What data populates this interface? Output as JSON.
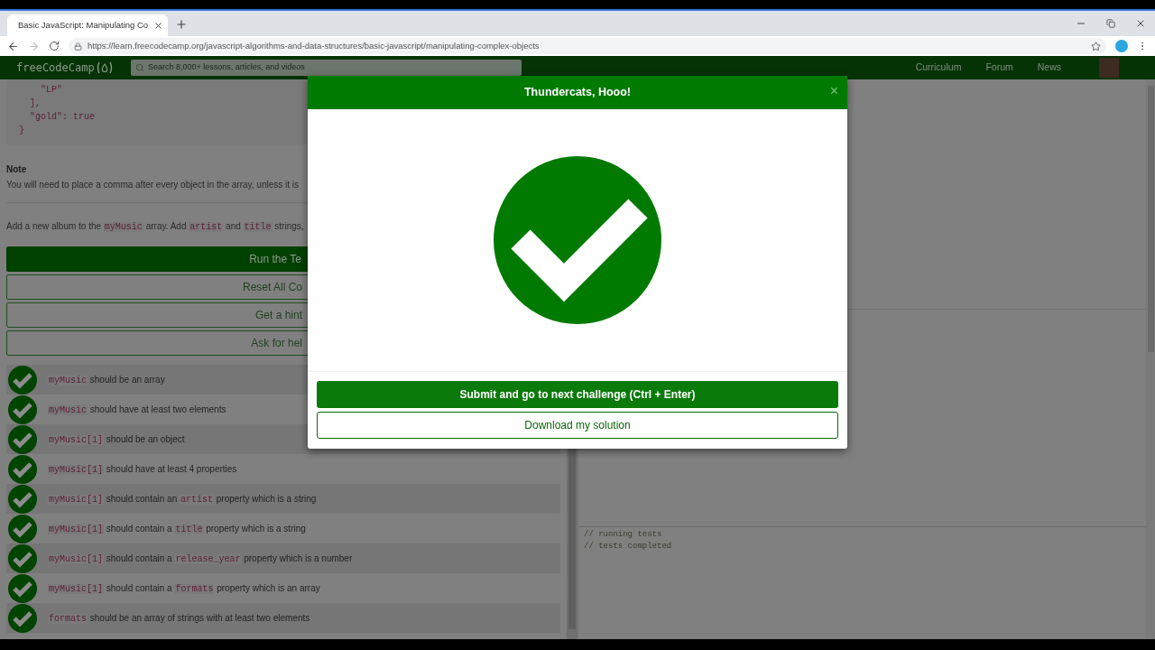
{
  "browser": {
    "tab": {
      "title": "Basic JavaScript: Manipulating Co",
      "selected": true
    },
    "url": "https://learn.freecodecamp.org/javascript-algorithms-and-data-structures/basic-javascript/manipulating-complex-objects"
  },
  "nav": {
    "logo": "freeCodeCamp",
    "search": {
      "placeholder": "Search 8,000+ lessons, articles, and videos"
    },
    "links": [
      "Curriculum",
      "Forum",
      "News"
    ]
  },
  "lesson": {
    "code_lines": [
      "    \"LP\"",
      "  ],",
      "  \"gold\": true",
      "}"
    ],
    "note": {
      "heading": "Note",
      "text": "You will need to place a comma after every object in the array, unless it is"
    },
    "instruction": [
      {
        "kind": "text",
        "text": "Add a new album to the "
      },
      {
        "kind": "code",
        "text": "myMusic"
      },
      {
        "kind": "text",
        "text": " array. Add "
      },
      {
        "kind": "code",
        "text": "artist"
      },
      {
        "kind": "text",
        "text": " and "
      },
      {
        "kind": "code",
        "text": "title"
      },
      {
        "kind": "text",
        "text": " strings,"
      }
    ],
    "buttons": [
      {
        "label": "Run the Te",
        "primary": true
      },
      {
        "label": "Reset All Co",
        "primary": false
      },
      {
        "label": "Get a hint",
        "primary": false
      },
      {
        "label": "Ask for hel",
        "primary": false
      }
    ],
    "tests": [
      {
        "passed": true,
        "parts": [
          {
            "kind": "code",
            "text": "myMusic"
          },
          {
            "kind": "text",
            "text": " should be an array"
          }
        ]
      },
      {
        "passed": true,
        "parts": [
          {
            "kind": "code",
            "text": "myMusic"
          },
          {
            "kind": "text",
            "text": " should have at least two elements"
          }
        ]
      },
      {
        "passed": true,
        "parts": [
          {
            "kind": "code",
            "text": "myMusic[1]"
          },
          {
            "kind": "text",
            "text": " should be an object"
          }
        ]
      },
      {
        "passed": true,
        "parts": [
          {
            "kind": "code",
            "text": "myMusic[1]"
          },
          {
            "kind": "text",
            "text": " should have at least 4 properties"
          }
        ]
      },
      {
        "passed": true,
        "parts": [
          {
            "kind": "code",
            "text": "myMusic[1]"
          },
          {
            "kind": "text",
            "text": " should contain an "
          },
          {
            "kind": "code",
            "text": "artist"
          },
          {
            "kind": "text",
            "text": " property which is a string"
          }
        ]
      },
      {
        "passed": true,
        "parts": [
          {
            "kind": "code",
            "text": "myMusic[1]"
          },
          {
            "kind": "text",
            "text": " should contain a "
          },
          {
            "kind": "code",
            "text": "title"
          },
          {
            "kind": "text",
            "text": " property which is a string"
          }
        ]
      },
      {
        "passed": true,
        "parts": [
          {
            "kind": "code",
            "text": "myMusic[1]"
          },
          {
            "kind": "text",
            "text": " should contain a "
          },
          {
            "kind": "code",
            "text": "release_year"
          },
          {
            "kind": "text",
            "text": " property which is a number"
          }
        ]
      },
      {
        "passed": true,
        "parts": [
          {
            "kind": "code",
            "text": "myMusic[1]"
          },
          {
            "kind": "text",
            "text": " should contain a "
          },
          {
            "kind": "code",
            "text": "formats"
          },
          {
            "kind": "text",
            "text": " property which is an array"
          }
        ]
      },
      {
        "passed": true,
        "parts": [
          {
            "kind": "code",
            "text": "formats"
          },
          {
            "kind": "text",
            "text": " should be an array of strings with at least two elements"
          }
        ]
      }
    ]
  },
  "console": [
    "// running tests",
    "// tests completed"
  ],
  "modal": {
    "title": "Thundercats, Hooo!",
    "close": "×",
    "buttons": [
      {
        "label": "Submit and go to next challenge (Ctrl + Enter)",
        "primary": true
      },
      {
        "label": "Download my solution",
        "primary": false
      }
    ]
  }
}
